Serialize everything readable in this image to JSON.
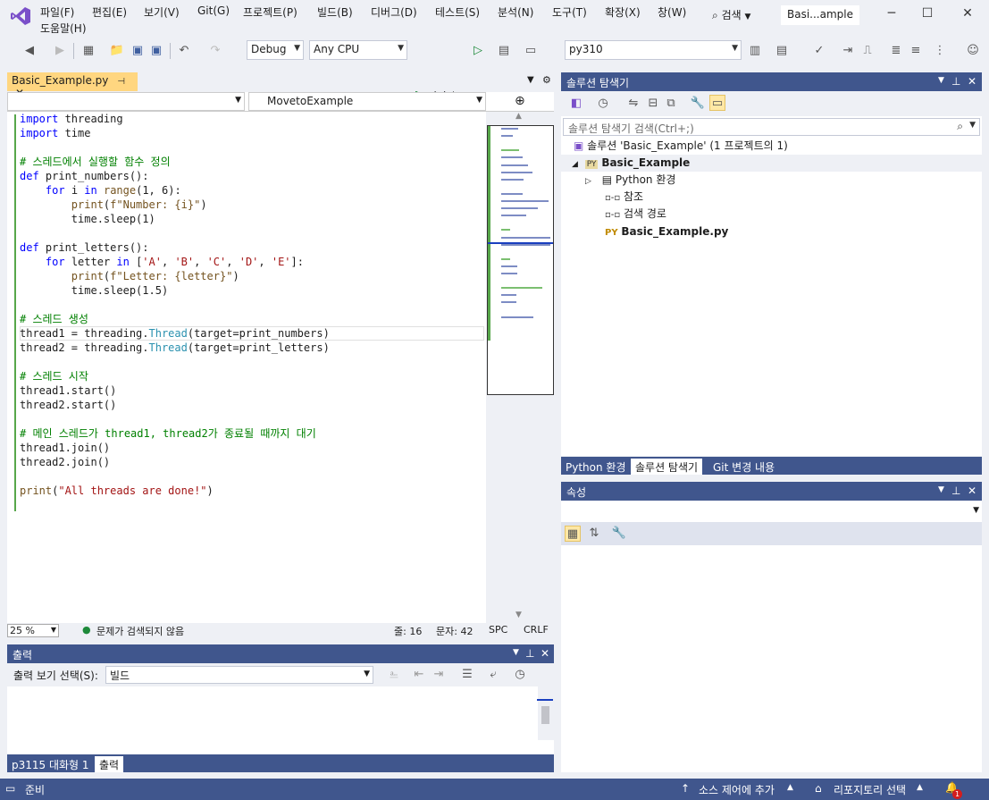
{
  "menu": [
    "파일(F)",
    "편집(E)",
    "보기(V)",
    "Git(G)",
    "프로젝트(P)",
    "빌드(B)",
    "디버그(D)",
    "테스트(S)",
    "분석(N)",
    "도구(T)",
    "확장(X)",
    "창(W)",
    "도움말(H)"
  ],
  "search_label": "검색",
  "solution_name": "Basi...ample",
  "toolbar": {
    "config": "Debug",
    "platform": "Any CPU",
    "start_label": "시작",
    "env": "py310"
  },
  "editor": {
    "tab_label": "Basic_Example.py",
    "nav_member": "MovetoExample",
    "zoom": "25 %",
    "issues": "문제가 검색되지 않음",
    "line": "줄: 16",
    "col": "문자: 42",
    "spc": "SPC",
    "crlf": "CRLF"
  },
  "code_lines": [
    "import threading",
    "import time",
    "",
    "# 스레드에서 실행할 함수 정의",
    "def print_numbers():",
    "    for i in range(1, 6):",
    "        print(f\"Number: {i}\")",
    "        time.sleep(1)",
    "",
    "def print_letters():",
    "    for letter in ['A', 'B', 'C', 'D', 'E']:",
    "        print(f\"Letter: {letter}\")",
    "        time.sleep(1.5)",
    "",
    "# 스레드 생성",
    "thread1 = threading.Thread(target=print_numbers)",
    "thread2 = threading.Thread(target=print_letters)",
    "",
    "# 스레드 시작",
    "thread1.start()",
    "thread2.start()",
    "",
    "# 메인 스레드가 thread1, thread2가 종료될 때까지 대기",
    "thread1.join()",
    "thread2.join()",
    "",
    "print(\"All threads are done!\")"
  ],
  "output": {
    "title": "출력",
    "source_label": "출력 보기 선택(S):",
    "source_value": "빌드",
    "tabs": [
      "p3115 대화형 1",
      "출력"
    ]
  },
  "solution_explorer": {
    "title": "솔루션 탐색기",
    "search_placeholder": "솔루션 탐색기 검색(Ctrl+;)",
    "items": [
      "솔루션 'Basic_Example' (1 프로젝트의 1)",
      "Basic_Example",
      "Python 환경",
      "참조",
      "검색 경로",
      "Basic_Example.py"
    ],
    "tabs": [
      "Python 환경",
      "솔루션 탐색기",
      "Git 변경 내용"
    ]
  },
  "properties": {
    "title": "속성"
  },
  "statusbar": {
    "ready": "준비",
    "source_control": "소스 제어에 추가",
    "repo": "리포지토리 선택",
    "notif_count": "1"
  },
  "colors": {
    "accent": "#40568d",
    "tab_active": "#ffd680",
    "keyword": "#0000ff",
    "comment": "#008000",
    "string": "#a31515"
  }
}
